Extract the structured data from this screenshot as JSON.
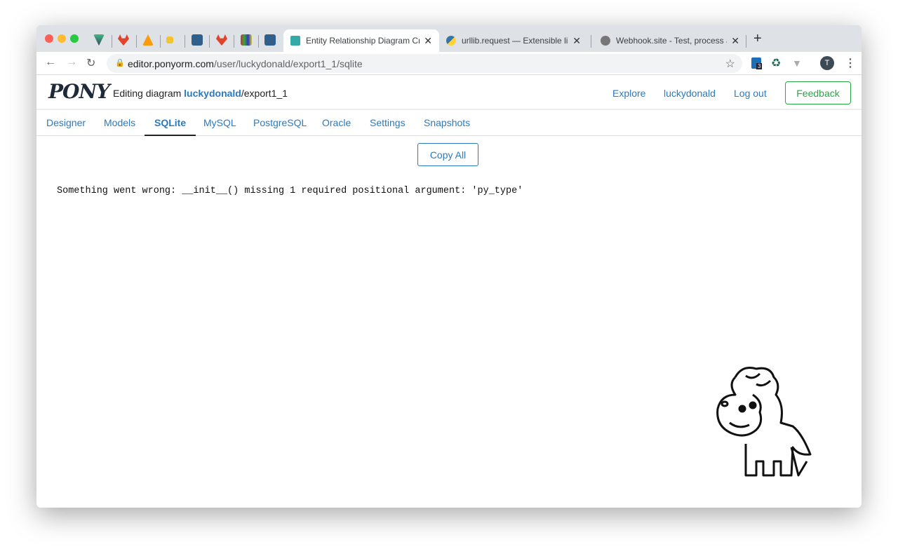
{
  "browser": {
    "tabs": [
      {
        "title": "Entity Relationship Diagram Cr",
        "active": true
      },
      {
        "title": "urllib.request — Extensible libr",
        "active": false
      },
      {
        "title": "Webhook.site - Test, process a",
        "active": false
      }
    ],
    "url_host": "editor.ponyorm.com",
    "url_path": "/user/luckydonald/export1_1/sqlite",
    "extension_badge": "3",
    "profile_initial": "T"
  },
  "header": {
    "logo": "PONY",
    "editing_prefix": "Editing diagram ",
    "user": "luckydonald",
    "diagram": "/export1_1",
    "explore": "Explore",
    "username": "luckydonald",
    "logout": "Log out",
    "feedback": "Feedback"
  },
  "nav": {
    "items": [
      "Designer",
      "Models",
      "SQLite",
      "MySQL",
      "PostgreSQL",
      "Oracle",
      "Settings",
      "Snapshots"
    ],
    "active": "SQLite"
  },
  "main": {
    "copy_all": "Copy All",
    "error": "Something went wrong: __init__() missing 1 required positional argument: 'py_type'"
  }
}
